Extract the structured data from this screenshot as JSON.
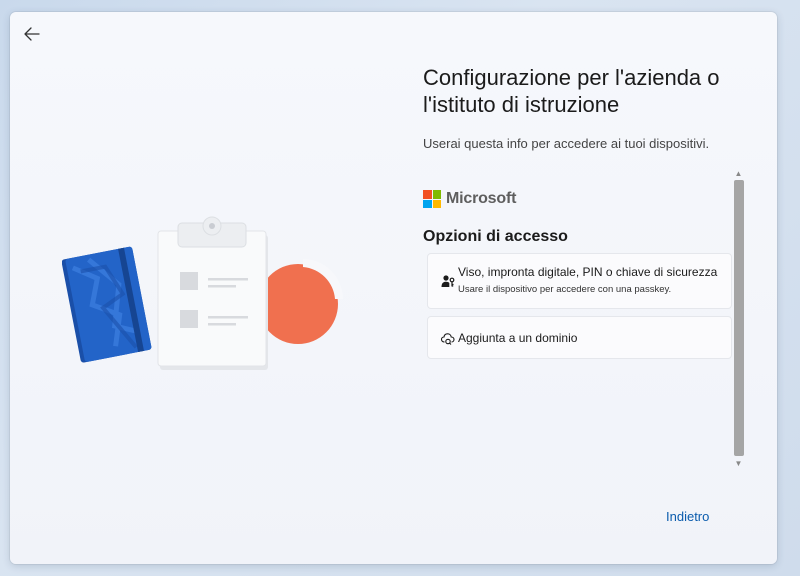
{
  "header": {
    "back_icon": "arrow-left-icon"
  },
  "main": {
    "title": "Configurazione per l'azienda o l'istituto di istruzione",
    "subtitle": "Userai questa info per accedere ai tuoi dispositivi."
  },
  "brand": {
    "name": "Microsoft",
    "colors": [
      "#f25022",
      "#7fba00",
      "#00a4ef",
      "#ffb900"
    ]
  },
  "signin_options": {
    "heading": "Opzioni di accesso",
    "items": [
      {
        "icon": "person-key-icon",
        "title": "Viso, impronta digitale, PIN o chiave di sicurezza",
        "description": "Usare il dispositivo per accedere con una passkey."
      },
      {
        "icon": "cloud-domain-icon",
        "title": "Aggiunta a un dominio"
      }
    ]
  },
  "footer": {
    "back_label": "Indietro"
  },
  "colors": {
    "accent": "#0b5cad",
    "pie": "#f0704f",
    "notebook": "#1f5fbf"
  }
}
